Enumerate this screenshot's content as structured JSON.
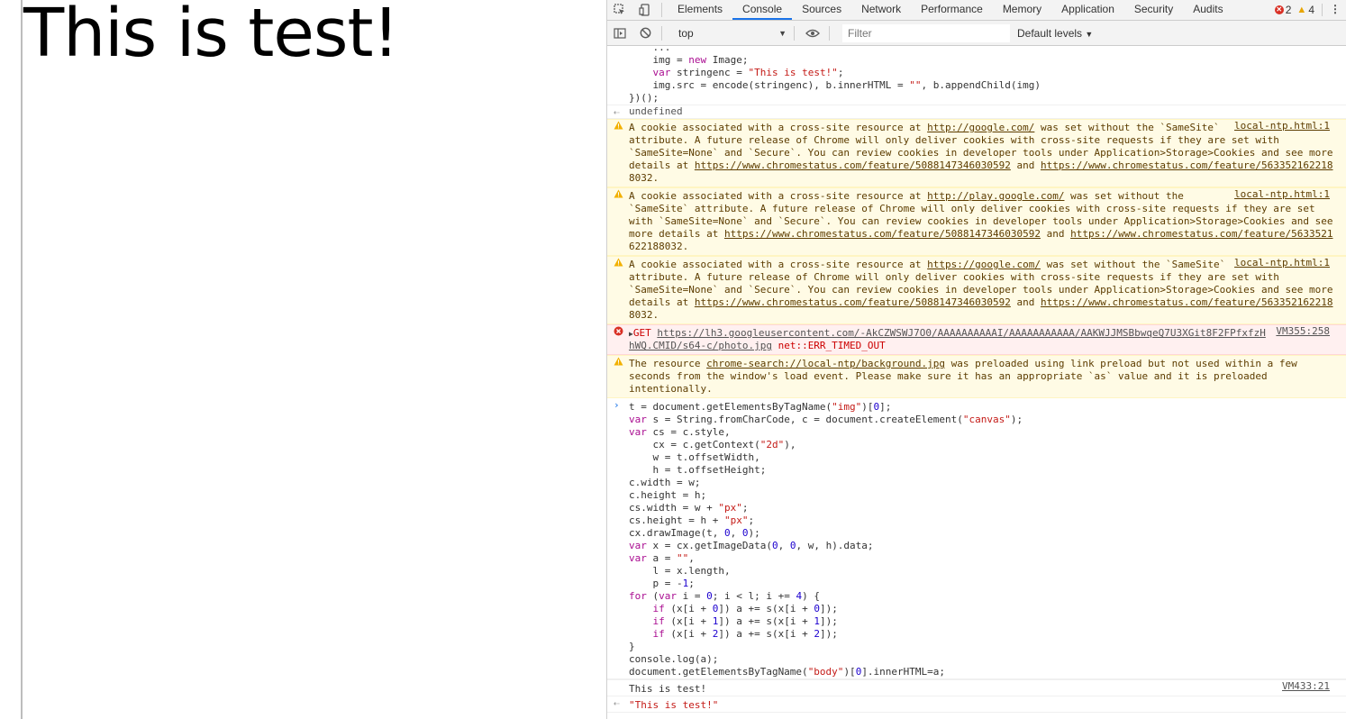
{
  "page": {
    "heading": "This is test!"
  },
  "devtools": {
    "tabs": [
      "Elements",
      "Console",
      "Sources",
      "Network",
      "Performance",
      "Memory",
      "Application",
      "Security",
      "Audits"
    ],
    "active_tab": "Console",
    "error_count": "2",
    "warning_count": "4",
    "context": "top",
    "filter_placeholder": "Filter",
    "levels": "Default levels",
    "colors": {
      "accent": "#1a73e8",
      "warning_bg": "#fffbe5",
      "error_bg": "#fff0f0"
    },
    "icons": {
      "inspect": "inspect-element-icon",
      "device": "device-toolbar-icon",
      "sidebar": "console-sidebar-icon",
      "clear": "clear-console-icon",
      "eye": "live-expression-icon",
      "kebab": "more-options-icon"
    }
  },
  "console": {
    "prev_code": [
      "    ...",
      "    img = new Image;",
      "    var stringenc = \"This is test!\";",
      "    img.src = encode(stringenc), b.innerHTML = \"\", b.appendChild(img)",
      "})();"
    ],
    "result1": "undefined",
    "warnings": [
      {
        "source": "local-ntp.html:1",
        "lines": [
          "A cookie associated with a cross-site resource at http://google.com/ was set without the `SameSite`",
          "attribute. A future release of Chrome will only deliver cookies with cross-site requests if they are set with",
          "`SameSite=None` and `Secure`. You can review cookies in developer tools under Application>Storage>Cookies and see more",
          "details at https://www.chromestatus.com/feature/5088147346030592 and https://www.chromestatus.com/feature/563352162218",
          "8032."
        ]
      },
      {
        "source": "local-ntp.html:1",
        "lines": [
          "A cookie associated with a cross-site resource at http://play.google.com/ was set without the",
          "`SameSite` attribute. A future release of Chrome will only deliver cookies with cross-site requests if they are set",
          "with `SameSite=None` and `Secure`. You can review cookies in developer tools under Application>Storage>Cookies and see",
          "more details at https://www.chromestatus.com/feature/5088147346030592 and https://www.chromestatus.com/feature/5633521",
          "622188032."
        ]
      },
      {
        "source": "local-ntp.html:1",
        "lines": [
          "A cookie associated with a cross-site resource at https://google.com/ was set without the `SameSite`",
          "attribute. A future release of Chrome will only deliver cookies with cross-site requests if they are set with",
          "`SameSite=None` and `Secure`. You can review cookies in developer tools under Application>Storage>Cookies and see more",
          "details at https://www.chromestatus.com/feature/5088147346030592 and https://www.chromestatus.com/feature/563352162218",
          "8032."
        ]
      }
    ],
    "error": {
      "method": "GET",
      "url_line1": "https://lh3.googleusercontent.com/-AkCZWSWJ7O0/AAAAAAAAAAI/AAAAAAAAAAA/AAKWJJMSBbwqeQ7U3XGit8F2FPfxfzH",
      "url_line2": "hWQ.CMID/s64-c/photo.jpg",
      "status": "net::ERR_TIMED_OUT",
      "source": "VM355:258"
    },
    "preload_warning": {
      "lines": [
        "The resource chrome-search://local-ntp/background.jpg was preloaded using link preload but not used within a few",
        "seconds from the window's load event. Please make sure it has an appropriate `as` value and it is preloaded",
        "intentionally."
      ]
    },
    "input_code": [
      "t = document.getElementsByTagName(\"img\")[0];",
      "var s = String.fromCharCode, c = document.createElement(\"canvas\");",
      "var cs = c.style,",
      "    cx = c.getContext(\"2d\"),",
      "    w = t.offsetWidth,",
      "    h = t.offsetHeight;",
      "c.width = w;",
      "c.height = h;",
      "cs.width = w + \"px\";",
      "cs.height = h + \"px\";",
      "cx.drawImage(t, 0, 0);",
      "var x = cx.getImageData(0, 0, w, h).data;",
      "var a = \"\",",
      "    l = x.length,",
      "    p = -1;",
      "for (var i = 0; i < l; i += 4) {",
      "    if (x[i + 0]) a += s(x[i + 0]);",
      "    if (x[i + 1]) a += s(x[i + 1]);",
      "    if (x[i + 2]) a += s(x[i + 2]);",
      "}",
      "console.log(a);",
      "document.getElementsByTagName(\"body\")[0].innerHTML=a;"
    ],
    "log": {
      "text": "This is test!",
      "source": "VM433:21"
    },
    "result2": "\"This is test!\""
  }
}
